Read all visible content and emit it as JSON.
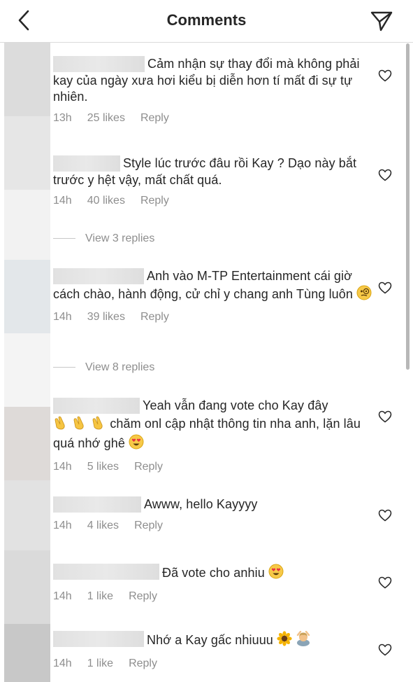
{
  "header": {
    "title": "Comments"
  },
  "comments": [
    {
      "text": "Cảm nhận sự thay đổi mà không phải kay của ngày xưa hơi kiểu bị diễn hơn tí mất đi sự tự nhiên.",
      "time": "13h",
      "likes": "25 likes",
      "reply": "Reply"
    },
    {
      "text": "Style lúc trước đâu rồi Kay ? Dạo này bắt trước y hệt vậy, mất chất quá.",
      "time": "14h",
      "likes": "40 likes",
      "reply": "Reply"
    },
    {
      "text": "Anh vào M-TP Entertainment cái giờ cách chào, hành động, cử chỉ y chang anh Tùng luôn",
      "time": "14h",
      "likes": "39 likes",
      "reply": "Reply"
    },
    {
      "text_line1": "Yeah vẫn đang vote cho Kay đây",
      "text_line2": "chăm onl cập nhật thông tin nha anh, lặn lâu quá nhớ ghê",
      "time": "14h",
      "likes": "5 likes",
      "reply": "Reply"
    },
    {
      "text": "Awww, hello Kayyyy",
      "time": "14h",
      "likes": "4 likes",
      "reply": "Reply"
    },
    {
      "text": "Đã vote cho anhiu",
      "time": "14h",
      "likes": "1 like",
      "reply": "Reply"
    },
    {
      "text": "Nhớ a Kay gấc nhiuuu",
      "time": "14h",
      "likes": "1 like",
      "reply": "Reply"
    }
  ],
  "view_replies": [
    "View 3 replies",
    "View 8 replies"
  ],
  "icons": {
    "back": "chevron-left-icon",
    "share": "paper-plane-icon",
    "like": "heart-outline-icon"
  },
  "colors": {
    "text": "#262626",
    "secondary": "#8e8e8e"
  }
}
